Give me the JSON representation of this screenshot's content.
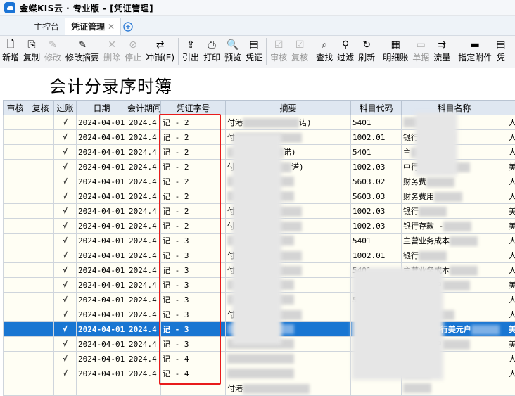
{
  "app": {
    "title": "金蝶KIS云 · 专业版 - [凭证管理]"
  },
  "tabs": [
    {
      "label": "主控台"
    },
    {
      "label": "凭证管理",
      "close": "✕"
    }
  ],
  "toolbar": [
    {
      "label": "新增",
      "icon": "new-icon",
      "enabled": true
    },
    {
      "label": "复制",
      "icon": "copy-icon",
      "enabled": true
    },
    {
      "label": "修改",
      "icon": "edit-icon",
      "enabled": false
    },
    {
      "label": "修改摘要",
      "icon": "edit-summary-icon",
      "enabled": true
    },
    {
      "label": "删除",
      "icon": "delete-icon",
      "enabled": false
    },
    {
      "label": "停止",
      "icon": "stop-icon",
      "enabled": false
    },
    {
      "label": "冲销(E)",
      "icon": "reverse-icon",
      "enabled": true
    },
    {
      "label": "引出",
      "icon": "export-icon",
      "enabled": true
    },
    {
      "label": "打印",
      "icon": "print-icon",
      "enabled": true
    },
    {
      "label": "预览",
      "icon": "preview-icon",
      "enabled": true
    },
    {
      "label": "凭证",
      "icon": "voucher-icon",
      "enabled": true
    },
    {
      "label": "审核",
      "icon": "audit-icon",
      "enabled": false
    },
    {
      "label": "复核",
      "icon": "recheck-icon",
      "enabled": false
    },
    {
      "label": "查找",
      "icon": "find-icon",
      "enabled": true
    },
    {
      "label": "过滤",
      "icon": "filter-icon",
      "enabled": true
    },
    {
      "label": "刷新",
      "icon": "refresh-icon",
      "enabled": true
    },
    {
      "label": "明细账",
      "icon": "ledger-icon",
      "enabled": true
    },
    {
      "label": "单据",
      "icon": "document-icon",
      "enabled": false
    },
    {
      "label": "流量",
      "icon": "flow-icon",
      "enabled": true
    },
    {
      "label": "指定附件",
      "icon": "attachment-icon",
      "enabled": true
    },
    {
      "label": "凭",
      "icon": "voucher2-icon",
      "enabled": true
    }
  ],
  "page_title": "会计分录序时簿",
  "columns": [
    "审核",
    "复核",
    "过账",
    "日期",
    "会计期间",
    "凭证字号",
    "摘要",
    "科目代码",
    "科目名称",
    ""
  ],
  "rows": [
    {
      "posted": "√",
      "date": "2024-04-01",
      "period": "2024.4",
      "voucher": "记 - 2",
      "summary": "付港",
      "summary_tail": "诺)",
      "code": "5401",
      "name": "",
      "extra": "人"
    },
    {
      "posted": "√",
      "date": "2024-04-01",
      "period": "2024.4",
      "voucher": "记 - 2",
      "summary": "付",
      "summary_tail": "",
      "code": "1002.01",
      "name": "银行存",
      "extra": "人"
    },
    {
      "posted": "√",
      "date": "2024-04-01",
      "period": "2024.4",
      "voucher": "记 - 2",
      "summary": "",
      "summary_tail": "诺)",
      "code": "5401",
      "name": "主",
      "extra": "人"
    },
    {
      "posted": "√",
      "date": "2024-04-01",
      "period": "2024.4",
      "voucher": "记 - 2",
      "summary": "付",
      "summary_tail": "诺)",
      "code": "1002.03",
      "name": "中行美元户",
      "extra": "美"
    },
    {
      "posted": "√",
      "date": "2024-04-01",
      "period": "2024.4",
      "voucher": "记 - 2",
      "summary": "",
      "summary_tail": "",
      "code": "5603.02",
      "name": "财务费",
      "extra": "人"
    },
    {
      "posted": "√",
      "date": "2024-04-01",
      "period": "2024.4",
      "voucher": "记 - 2",
      "summary": "",
      "summary_tail": "",
      "code": "5603.03",
      "name": "财务费用",
      "extra": "人"
    },
    {
      "posted": "√",
      "date": "2024-04-01",
      "period": "2024.4",
      "voucher": "记 - 2",
      "summary": "付",
      "summary_tail": "",
      "code": "1002.03",
      "name": "银行",
      "extra": "美"
    },
    {
      "posted": "√",
      "date": "2024-04-01",
      "period": "2024.4",
      "voucher": "记 - 2",
      "summary": "付",
      "summary_tail": "",
      "code": "1002.03",
      "name": "银行存款 -",
      "extra": "美"
    },
    {
      "posted": "√",
      "date": "2024-04-01",
      "period": "2024.4",
      "voucher": "记 - 3",
      "summary": "",
      "summary_tail": "",
      "code": "5401",
      "name": "主营业务成本",
      "extra": "人"
    },
    {
      "posted": "√",
      "date": "2024-04-01",
      "period": "2024.4",
      "voucher": "记 - 3",
      "summary": "付",
      "summary_tail": "",
      "code": "1002.01",
      "name": "银行",
      "extra": "人"
    },
    {
      "posted": "√",
      "date": "2024-04-01",
      "period": "2024.4",
      "voucher": "记 - 3",
      "summary": "付",
      "summary_tail": "",
      "code": "5401",
      "name": "主营业务成本",
      "extra": "人"
    },
    {
      "posted": "√",
      "date": "2024-04-01",
      "period": "2024.4",
      "voucher": "记 - 3",
      "summary": "",
      "summary_tail": "",
      "code": "",
      "name": "中行美元户",
      "extra": "美"
    },
    {
      "posted": "√",
      "date": "2024-04-01",
      "period": "2024.4",
      "voucher": "记 - 3",
      "summary": "",
      "summary_tail": "",
      "code": "5603",
      "name": "费",
      "extra": "人"
    },
    {
      "posted": "√",
      "date": "2024-04-01",
      "period": "2024.4",
      "voucher": "记 - 3",
      "summary": "付",
      "summary_tail": "",
      "code": "",
      "name": "财务费",
      "extra": "人"
    },
    {
      "posted": "√",
      "date": "2024-04-01",
      "period": "2024.4",
      "voucher": "记 - 3",
      "summary": "",
      "summary_tail": "",
      "code": "",
      "name": "银行 - 中行美元户",
      "extra": "美",
      "selected": true
    },
    {
      "posted": "√",
      "date": "2024-04-01",
      "period": "2024.4",
      "voucher": "记 - 3",
      "summary": "",
      "summary_tail": "",
      "code": "",
      "name": "中行美元户",
      "extra": "美"
    },
    {
      "posted": "√",
      "date": "2024-04-01",
      "period": "2024.4",
      "voucher": "记 - 4",
      "summary": "",
      "summary_tail": "",
      "code": "",
      "name": "",
      "extra": "人"
    },
    {
      "posted": "√",
      "date": "2024-04-01",
      "period": "2024.4",
      "voucher": "记 - 4",
      "summary": "",
      "summary_tail": "",
      "code": "",
      "name": "",
      "extra": "人"
    },
    {
      "posted": "",
      "date": "",
      "period": "",
      "voucher": "",
      "summary": "付港",
      "summary_tail": "",
      "code": "",
      "name": "",
      "extra": ""
    }
  ],
  "colors": {
    "accent": "#1976d2",
    "highlight_box": "#e81b1b",
    "header_bg": "#dfe7f1",
    "row_bg": "#fffef4"
  }
}
